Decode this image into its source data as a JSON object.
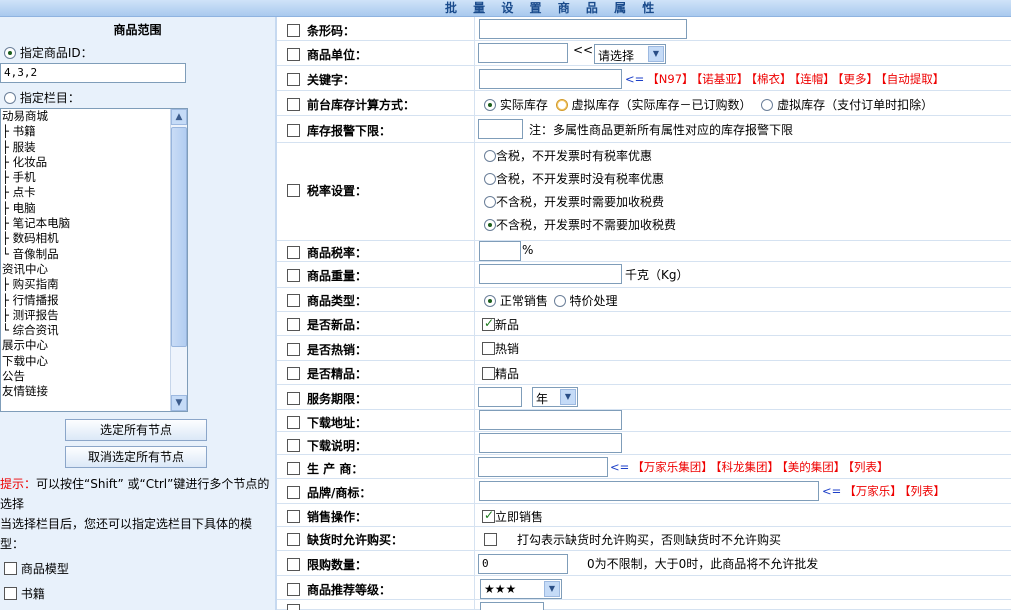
{
  "page_title": "批 量 设 置 商 品 属 性",
  "scope": {
    "heading": "商品范围",
    "option_ids": "指定商品ID：",
    "ids_value": "4,3,2",
    "option_columns": "指定栏目：",
    "tree": [
      "动易商城",
      "├ 书籍",
      "├ 服装",
      "├ 化妆品",
      "├ 手机",
      "├ 点卡",
      "├ 电脑",
      "├ 笔记本电脑",
      "├ 数码相机",
      "└ 音像制品",
      "资讯中心",
      "├ 购买指南",
      "├ 行情播报",
      "├ 测评报告",
      "└ 综合资讯",
      "展示中心",
      "下载中心",
      "公告",
      "友情链接"
    ],
    "select_all": "选定所有节点",
    "deselect_all": "取消选定所有节点",
    "tip_prefix": "提示：",
    "tip_text": "可以按住“Shift” 或“Ctrl”键进行多个节点的选择",
    "tip_text2": "当选择栏目后，您还可以指定选栏目下具体的模型：",
    "models": [
      "商品模型",
      "书籍"
    ]
  },
  "fields": {
    "barcode": {
      "label": "条形码："
    },
    "unit": {
      "label": "商品单位：",
      "arrow": "<<",
      "select": "请选择"
    },
    "keyword": {
      "label": "关键字：",
      "arrow": "<=",
      "links": [
        "【N97】",
        "【诺基亚】",
        "【棉衣】",
        "【连帽】",
        "【更多】",
        "【自动提取】"
      ]
    },
    "stock_calc": {
      "label": "前台库存计算方式：",
      "options": [
        "实际库存",
        "虚拟库存（实际库存－已订购数）",
        "虚拟库存（支付订单时扣除）"
      ]
    },
    "stock_alarm": {
      "label": "库存报警下限：",
      "note": "注：多属性商品更新所有属性对应的库存报警下限"
    },
    "tax": {
      "label": "税率设置：",
      "options": [
        "含税，不开发票时有税率优惠",
        "含税，不开发票时没有税率优惠",
        "不含税，开发票时需要加收税费",
        "不含税，开发票时不需要加收税费"
      ]
    },
    "tax_rate": {
      "label": "商品税率：",
      "unit": "%"
    },
    "weight": {
      "label": "商品重量：",
      "unit": "千克（Kg）"
    },
    "type": {
      "label": "商品类型：",
      "options": [
        "正常销售",
        "特价处理"
      ]
    },
    "is_new": {
      "label": "是否新品：",
      "text": "新品"
    },
    "is_hot": {
      "label": "是否热销：",
      "text": "热销"
    },
    "is_best": {
      "label": "是否精品：",
      "text": "精品"
    },
    "service": {
      "label": "服务期限：",
      "select": "年"
    },
    "download_url": {
      "label": "下载地址："
    },
    "download_desc": {
      "label": "下载说明："
    },
    "producer": {
      "label": "生 产 商：",
      "arrow": "<=",
      "links": [
        "【万家乐集团】",
        "【科龙集团】",
        "【美的集团】",
        "【列表】"
      ]
    },
    "brand": {
      "label": "品牌/商标：",
      "arrow": "<=",
      "links": [
        "【万家乐】",
        "【列表】"
      ]
    },
    "sale_op": {
      "label": "销售操作：",
      "text": "立即销售"
    },
    "oos_buy": {
      "label": "缺货时允许购买：",
      "text": "打勾表示缺货时允许购买，否则缺货时不允许购买"
    },
    "limit": {
      "label": "限购数量：",
      "value": "0",
      "note": "0为不限制，大于0时，此商品将不允许批发"
    },
    "recommend": {
      "label": "商品推荐等级：",
      "select": "★★★"
    }
  },
  "colors": {
    "accent_red": "#e00000",
    "link_blue": "#1c3fc8",
    "panel_bg": "#e8f1fb"
  }
}
